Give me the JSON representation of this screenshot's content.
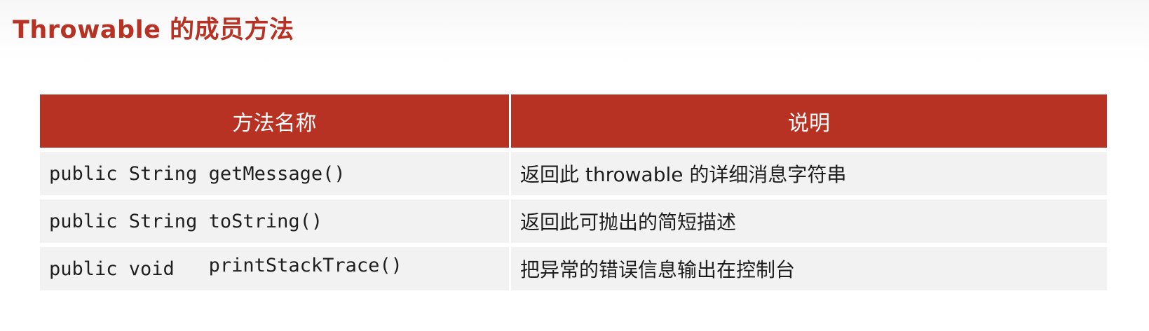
{
  "slide": {
    "title": "Throwable 的成员方法"
  },
  "table": {
    "headers": {
      "method": "方法名称",
      "description": "说明"
    },
    "rows": [
      {
        "modifiers": "public String ",
        "name": "getMessage()",
        "description": "返回此 throwable 的详细消息字符串"
      },
      {
        "modifiers": "public String ",
        "name": "toString()",
        "description": "返回此可抛出的简短描述"
      },
      {
        "modifiers": "public void   ",
        "name": "printStackTrace()",
        "description": "把异常的错误信息输出在控制台"
      }
    ]
  }
}
